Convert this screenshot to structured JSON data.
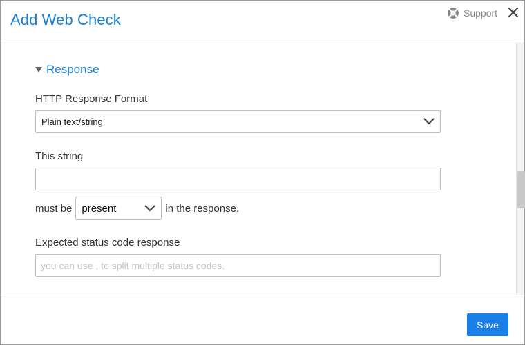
{
  "dialog": {
    "title": "Add Web Check",
    "support_label": "Support",
    "accent_color": "#1a7fd4",
    "icons": {
      "support": "lifebuoy-icon",
      "close": "close-icon"
    }
  },
  "section": {
    "title": "Response",
    "expanded": true
  },
  "form": {
    "response_format": {
      "label": "HTTP Response Format",
      "selected": "Plain text/string"
    },
    "this_string": {
      "label": "This string",
      "value": ""
    },
    "condition": {
      "prefix": "must be",
      "selected": "present",
      "suffix": "in the response."
    },
    "status_code": {
      "label": "Expected status code response",
      "value": "",
      "placeholder": "you can use , to split multiple status codes."
    }
  },
  "footer": {
    "save_label": "Save",
    "save_color": "#1a7fe6"
  }
}
